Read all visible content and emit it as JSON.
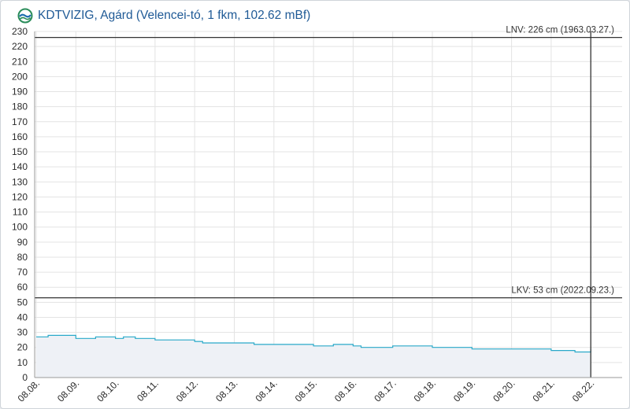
{
  "header": {
    "title": "KDTVIZIG, Agárd (Velencei-tó, 1 fkm, 102.62 mBf)",
    "logo_icon": "water-drop-logo-icon"
  },
  "colors": {
    "line": "#29a9c9",
    "fill": "#eef1f6",
    "grid": "#e3e3e3",
    "reference": "#333333",
    "title": "#1f5a96"
  },
  "chart_data": {
    "type": "area",
    "title": "KDTVIZIG, Agárd (Velencei-tó, 1 fkm, 102.62 mBf)",
    "xlabel": "",
    "ylabel": "",
    "ylim": [
      0,
      230
    ],
    "yticks": [
      0,
      10,
      20,
      30,
      40,
      50,
      60,
      70,
      80,
      90,
      100,
      110,
      120,
      130,
      140,
      150,
      160,
      170,
      180,
      190,
      200,
      210,
      220,
      230
    ],
    "x_tick_labels": [
      "08.08.",
      "08.09.",
      "08.10.",
      "08.11.",
      "08.12.",
      "08.13.",
      "08.14.",
      "08.15.",
      "08.16.",
      "08.17.",
      "08.18.",
      "08.19.",
      "08.20.",
      "08.21.",
      "08.22."
    ],
    "grid": true,
    "series": [
      {
        "x": [
          0,
          0.3,
          0.6,
          1.0,
          1.5,
          2.0,
          2.2,
          2.5,
          3.0,
          3.5,
          4.0,
          4.2,
          4.5,
          5.0,
          5.5,
          6.0,
          6.5,
          7.0,
          7.5,
          8.0,
          8.2,
          8.5,
          9.0,
          9.5,
          10.0,
          10.5,
          11.0,
          11.5,
          12.0,
          12.5,
          13.0,
          13.3,
          13.6,
          13.9,
          14.0
        ],
        "values": [
          27,
          28,
          28,
          26,
          27,
          26,
          27,
          26,
          25,
          25,
          24,
          23,
          23,
          23,
          22,
          22,
          22,
          21,
          22,
          21,
          20,
          20,
          21,
          21,
          20,
          20,
          19,
          19,
          19,
          19,
          18,
          18,
          17,
          17,
          19
        ]
      }
    ],
    "reference_lines": [
      {
        "label": "LNV: 226 cm (1963.03.27.)",
        "value": 226
      },
      {
        "label": "LKV: 53 cm (2022.09.23.)",
        "value": 53
      }
    ],
    "current_marker_x": 14.0
  }
}
